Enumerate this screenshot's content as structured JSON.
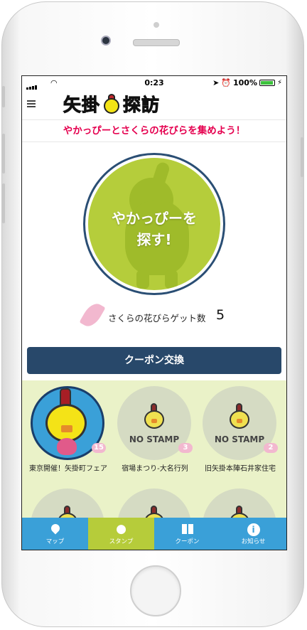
{
  "status_bar": {
    "time": "0:23",
    "battery": "100%"
  },
  "header": {
    "logo_left": "矢掛",
    "logo_right": "探訪",
    "headline": "やかっぴーとさくらの花びらを集めよう！"
  },
  "search": {
    "label_line1": "やかっぴーを",
    "label_line2": "探す!"
  },
  "petals": {
    "label": "さくらの花びらゲット数",
    "count": "5"
  },
  "coupon_button": "クーポン交換",
  "stamps": [
    {
      "label": "東京開催！矢掛町フェア",
      "badge": "15",
      "collected": true
    },
    {
      "label": "宿場まつり-大名行列",
      "badge": "3",
      "collected": false,
      "text": "NO STAMP"
    },
    {
      "label": "旧矢掛本陣石井家住宅",
      "badge": "2",
      "collected": false,
      "text": "NO STAMP"
    }
  ],
  "tabs": [
    {
      "label": "マップ",
      "icon": "map-pin-icon"
    },
    {
      "label": "スタンプ",
      "icon": "chick-icon"
    },
    {
      "label": "クーポン",
      "icon": "gift-icon"
    },
    {
      "label": "お知らせ",
      "icon": "info-icon"
    }
  ],
  "colors": {
    "accent_red": "#e5004f",
    "navy": "#28486a",
    "tab_blue": "#3aa0d8",
    "tab_active_green": "#b6cc3a",
    "stamp_bg": "#eaf2c8"
  }
}
